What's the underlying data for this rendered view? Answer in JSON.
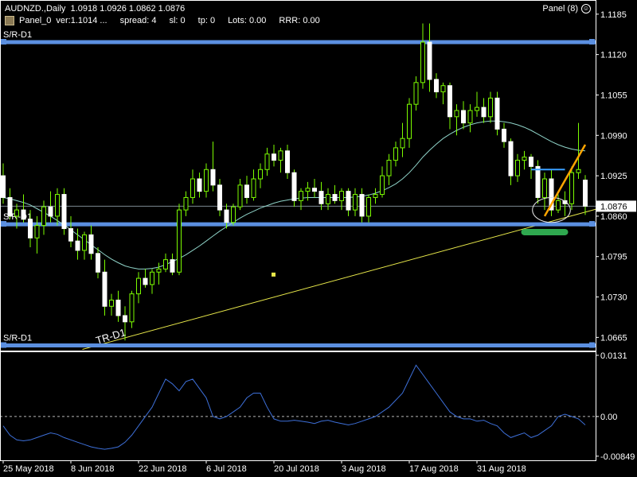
{
  "header": {
    "symbol_line": "AUDNZD.,Daily",
    "ohlc": "1.0918 1.0926 1.0862 1.0876",
    "panel_label": "Panel_0",
    "fields": [
      "ver:1.1014 ...",
      "spread: 4",
      "sl: 0",
      "tp: 0",
      "Lots: 0.00",
      "RRR: 0.00"
    ],
    "panel_button": "Panel (8)"
  },
  "colors": {
    "background": "#000000",
    "candle": "#7cfc00",
    "ma": "#8fd3c8",
    "sr_line": "#5b8fe0",
    "trend_line": "#e8e84a",
    "indicator": "#3d6fd8",
    "current_price_bg": "#ffffff"
  },
  "chart_data": [
    {
      "type": "candlestick",
      "symbol": "AUDNZD.",
      "timeframe": "Daily",
      "ylim": [
        1.0645,
        1.1195
      ],
      "yticks": [
        1.1185,
        1.112,
        1.1055,
        1.099,
        1.0925,
        1.086,
        1.0795,
        1.073,
        1.0665
      ],
      "ytick_labels": [
        "1.1185",
        "1.1120",
        "1.1055",
        "1.0990",
        "1.0925",
        "1.0860",
        "1.0795",
        "1.0730",
        "1.0665"
      ],
      "xtick_labels": [
        "25 May 2018",
        "8 Jun 2018",
        "22 Jun 2018",
        "6 Jul 2018",
        "20 Jul 2018",
        "3 Aug 2018",
        "17 Aug 2018",
        "31 Aug 2018"
      ],
      "current_price": "1.0876",
      "current_price_value": 1.0876,
      "candles": [
        [
          1.0925,
          1.0945,
          1.088,
          1.089
        ],
        [
          1.089,
          1.0905,
          1.0855,
          1.086
        ],
        [
          1.086,
          1.088,
          1.084,
          1.087
        ],
        [
          1.087,
          1.0895,
          1.085,
          1.0855
        ],
        [
          1.0855,
          1.087,
          1.081,
          1.0825
        ],
        [
          1.0825,
          1.086,
          1.08,
          1.0845
        ],
        [
          1.0845,
          1.0885,
          1.083,
          1.0875
        ],
        [
          1.0875,
          1.09,
          1.085,
          1.086
        ],
        [
          1.086,
          1.0905,
          1.0845,
          1.0895
        ],
        [
          1.0895,
          1.0905,
          1.083,
          1.084
        ],
        [
          1.084,
          1.086,
          1.081,
          1.082
        ],
        [
          1.082,
          1.084,
          1.079,
          1.0805
        ],
        [
          1.0805,
          1.0835,
          1.079,
          1.083
        ],
        [
          1.083,
          1.0845,
          1.079,
          1.08
        ],
        [
          1.08,
          1.081,
          1.076,
          1.077
        ],
        [
          1.077,
          1.079,
          1.07,
          1.0715
        ],
        [
          1.0715,
          1.0735,
          1.07,
          1.0725
        ],
        [
          1.0725,
          1.074,
          1.069,
          1.07
        ],
        [
          1.07,
          1.0715,
          1.066,
          1.069
        ],
        [
          1.069,
          1.074,
          1.068,
          1.0735
        ],
        [
          1.0735,
          1.077,
          1.072,
          1.076
        ],
        [
          1.076,
          1.0775,
          1.0745,
          1.075
        ],
        [
          1.075,
          1.0775,
          1.0735,
          1.077
        ],
        [
          1.077,
          1.0785,
          1.075,
          1.0775
        ],
        [
          1.0775,
          1.08,
          1.077,
          1.079
        ],
        [
          1.079,
          1.08,
          1.0765,
          1.077
        ],
        [
          1.077,
          1.088,
          1.0765,
          1.087
        ],
        [
          1.087,
          1.09,
          1.086,
          1.089
        ],
        [
          1.089,
          1.0935,
          1.088,
          1.092
        ],
        [
          1.092,
          1.093,
          1.089,
          1.09
        ],
        [
          1.09,
          1.0945,
          1.089,
          1.0935
        ],
        [
          1.0935,
          1.098,
          1.09,
          1.091
        ],
        [
          1.091,
          1.092,
          1.086,
          1.087
        ],
        [
          1.087,
          1.088,
          1.084,
          1.085
        ],
        [
          1.085,
          1.088,
          1.0845,
          1.0875
        ],
        [
          1.0875,
          1.092,
          1.087,
          1.091
        ],
        [
          1.091,
          1.0925,
          1.088,
          1.089
        ],
        [
          1.089,
          1.0935,
          1.0885,
          1.092
        ],
        [
          1.092,
          1.0945,
          1.0905,
          1.0935
        ],
        [
          1.0935,
          1.097,
          1.0925,
          1.096
        ],
        [
          1.096,
          1.0975,
          1.094,
          1.095
        ],
        [
          1.095,
          1.097,
          1.093,
          1.0965
        ],
        [
          1.0965,
          1.0975,
          1.092,
          1.093
        ],
        [
          1.093,
          1.0935,
          1.0875,
          1.0885
        ],
        [
          1.0885,
          1.0905,
          1.087,
          1.09
        ],
        [
          1.09,
          1.0915,
          1.0885,
          1.0905
        ],
        [
          1.0905,
          1.092,
          1.089,
          1.09
        ],
        [
          1.09,
          1.0915,
          1.087,
          1.088
        ],
        [
          1.088,
          1.0905,
          1.087,
          1.0895
        ],
        [
          1.0895,
          1.091,
          1.088,
          1.0885
        ],
        [
          1.0885,
          1.0905,
          1.087,
          1.09
        ],
        [
          1.09,
          1.0905,
          1.086,
          1.087
        ],
        [
          1.087,
          1.0905,
          1.086,
          1.0895
        ],
        [
          1.0895,
          1.0905,
          1.085,
          1.086
        ],
        [
          1.086,
          1.0895,
          1.085,
          1.089
        ],
        [
          1.089,
          1.0905,
          1.088,
          1.0895
        ],
        [
          1.0895,
          1.094,
          1.089,
          1.0925
        ],
        [
          1.0925,
          1.096,
          1.091,
          1.095
        ],
        [
          1.095,
          1.098,
          1.094,
          1.097
        ],
        [
          1.097,
          1.101,
          1.0955,
          1.0985
        ],
        [
          1.0985,
          1.105,
          1.097,
          1.104
        ],
        [
          1.104,
          1.1085,
          1.103,
          1.1075
        ],
        [
          1.1075,
          1.117,
          1.1065,
          1.114
        ],
        [
          1.114,
          1.117,
          1.106,
          1.108
        ],
        [
          1.108,
          1.109,
          1.105,
          1.106
        ],
        [
          1.106,
          1.1075,
          1.104,
          1.107
        ],
        [
          1.107,
          1.1075,
          1.1,
          1.102
        ],
        [
          1.102,
          1.104,
          1.099,
          1.103
        ],
        [
          1.103,
          1.1045,
          1.1,
          1.101
        ],
        [
          1.101,
          1.104,
          1.0995,
          1.103
        ],
        [
          1.103,
          1.106,
          1.102,
          1.1035
        ],
        [
          1.1035,
          1.105,
          1.101,
          1.102
        ],
        [
          1.102,
          1.106,
          1.101,
          1.105
        ],
        [
          1.105,
          1.106,
          1.099,
          1.1
        ],
        [
          1.1,
          1.101,
          1.097,
          1.098
        ],
        [
          1.098,
          1.0985,
          1.091,
          1.0925
        ],
        [
          1.0925,
          1.096,
          1.0915,
          1.095
        ],
        [
          1.095,
          1.0965,
          1.0935,
          1.0955
        ],
        [
          1.0955,
          1.096,
          1.092,
          1.094
        ],
        [
          1.094,
          1.095,
          1.088,
          1.089
        ],
        [
          1.089,
          1.093,
          1.087,
          1.092
        ],
        [
          1.092,
          1.0935,
          1.086,
          1.087
        ],
        [
          1.087,
          1.0895,
          1.0865,
          1.0885
        ],
        [
          1.0885,
          1.09,
          1.086,
          1.088
        ],
        [
          1.088,
          1.094,
          1.087,
          1.093
        ],
        [
          1.093,
          1.101,
          1.092,
          1.0935
        ],
        [
          1.0918,
          1.0926,
          1.0862,
          1.0876
        ]
      ],
      "ma_values": [
        1.089,
        1.0888,
        1.0885,
        1.0882,
        1.0878,
        1.0872,
        1.0866,
        1.086,
        1.0853,
        1.0846,
        1.0838,
        1.083,
        1.0822,
        1.0814,
        1.0806,
        1.0798,
        1.0791,
        1.0785,
        1.078,
        1.0777,
        1.0775,
        1.0775,
        1.0776,
        1.0778,
        1.0782,
        1.0787,
        1.0792,
        1.0798,
        1.0805,
        1.0812,
        1.082,
        1.0828,
        1.0836,
        1.0843,
        1.085,
        1.0857,
        1.0863,
        1.0868,
        1.0873,
        1.0877,
        1.0881,
        1.0884,
        1.0886,
        1.0888,
        1.0889,
        1.089,
        1.089,
        1.089,
        1.089,
        1.089,
        1.089,
        1.089,
        1.0891,
        1.0892,
        1.0894,
        1.0897,
        1.0901,
        1.0906,
        1.0912,
        1.092,
        1.093,
        1.0942,
        1.0955,
        1.0966,
        1.0976,
        1.0985,
        1.0992,
        1.0998,
        1.1003,
        1.1007,
        1.101,
        1.1012,
        1.1013,
        1.1013,
        1.1012,
        1.101,
        1.1007,
        1.1003,
        1.0998,
        1.0992,
        1.0986,
        1.098,
        1.0975,
        1.0971,
        1.0968,
        1.0966,
        1.0965
      ],
      "lines": [
        {
          "label": "S/R-D1",
          "kind": "horizontal",
          "value": 1.114
        },
        {
          "label": "S/R-D1",
          "kind": "horizontal",
          "value": 1.0847
        },
        {
          "label": "S/R-D1",
          "kind": "horizontal",
          "value": 1.0652
        },
        {
          "label": "TR-D1",
          "kind": "trend",
          "from": [
            17,
            1.0652
          ],
          "to": [
            87,
            1.0866
          ]
        }
      ],
      "annotations": {
        "orange_trend": {
          "from": [
            80,
            1.086
          ],
          "to": [
            86,
            1.0975
          ]
        },
        "short_blue_level": {
          "from": [
            78,
            1.0935
          ],
          "to": [
            83,
            1.0935
          ]
        },
        "ellipse": {
          "center": [
            81,
            1.087
          ],
          "rx_candles": 2.8,
          "ry_price": 0.002
        },
        "green_support": {
          "from": [
            77,
            1.0842
          ],
          "to": [
            83,
            1.0842
          ]
        }
      }
    },
    {
      "type": "line",
      "name": "",
      "ylim": [
        -0.0092,
        0.0136
      ],
      "yticks": [
        0.0131,
        0.0,
        -0.00849
      ],
      "ytick_labels": [
        "0.0131",
        "0.00",
        "-0.00849"
      ],
      "zero_line": 0.0,
      "values": [
        -0.002,
        -0.004,
        -0.005,
        -0.0052,
        -0.005,
        -0.0045,
        -0.004,
        -0.0035,
        -0.0038,
        -0.0045,
        -0.005,
        -0.0055,
        -0.006,
        -0.0065,
        -0.0068,
        -0.007,
        -0.0068,
        -0.0065,
        -0.0055,
        -0.004,
        -0.002,
        0.0,
        0.002,
        0.005,
        0.008,
        0.007,
        0.0055,
        0.0075,
        0.008,
        0.006,
        0.004,
        0.0,
        -0.0005,
        0.0,
        0.001,
        0.002,
        0.004,
        0.005,
        0.005,
        0.002,
        -0.0005,
        -0.001,
        -0.001,
        -0.0008,
        -0.001,
        -0.0012,
        -0.0015,
        -0.001,
        -0.0008,
        -0.0012,
        -0.0015,
        -0.0018,
        -0.0015,
        -0.001,
        -0.0005,
        0.0,
        0.001,
        0.002,
        0.0035,
        0.005,
        0.008,
        0.011,
        0.009,
        0.007,
        0.005,
        0.003,
        0.001,
        0.0,
        -0.0005,
        -0.0005,
        -0.001,
        -0.0008,
        -0.0015,
        -0.002,
        -0.0035,
        -0.0045,
        -0.004,
        -0.0035,
        -0.0045,
        -0.004,
        -0.003,
        -0.002,
        0.0,
        0.0005,
        0.0,
        -0.0005,
        -0.0018
      ]
    }
  ]
}
